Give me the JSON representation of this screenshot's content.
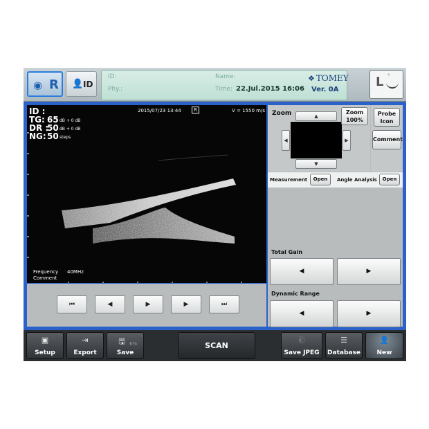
{
  "header": {
    "eye_button_label": "R",
    "id_button_label": "ID",
    "patient": {
      "id_label": "ID:",
      "name_label": "Name:",
      "phy_label": "Phy.:",
      "time_label": "Time:",
      "time_value": "22.Jul.2015  16:06"
    },
    "brand": "TOMEY",
    "version": "Ver. 0A",
    "probe_mode_label": "L"
  },
  "scan": {
    "date_time": "2015/07/23 13:44",
    "eye_badge": "R",
    "velocity": "V = 1550 m/s",
    "id_label": "ID :",
    "tg_label": "TG:",
    "tg_value": "65",
    "tg_unit": "dB + 0 dB",
    "dr_label": "DR :",
    "dr_value": "50",
    "dr_unit": "dB + 0 dB",
    "ng_label": "NG:",
    "ng_value": "50",
    "ng_unit": "steps",
    "frequency_label": "Frequency",
    "frequency_value": "40MHz",
    "comment_label": "Comment"
  },
  "playback": {
    "first_icon": "⏮",
    "prev_icon": "◀",
    "play_icon": "▶",
    "next_icon": "▶",
    "last_icon": "⏭"
  },
  "zoom": {
    "label": "Zoom",
    "zoom_button_line1": "Zoom",
    "zoom_button_line2": "100%",
    "probe_icon_line1": "Probe",
    "probe_icon_line2": "Icon",
    "comment_button": "Comment"
  },
  "analysis": {
    "measurement_label": "Measurement",
    "measurement_open": "Open",
    "angle_label": "Angle Analysis",
    "angle_open": "Open"
  },
  "controls": {
    "total_gain_label": "Total Gain",
    "dynamic_range_label": "Dynamic Range",
    "decrease_glyph": "◀",
    "increase_glyph": "▶"
  },
  "footer": {
    "setup": "Setup",
    "export": "Export",
    "save": "Save",
    "save_percent": "6%",
    "scan": "SCAN",
    "save_jpeg": "Save JPEG",
    "database": "Database",
    "new": "New"
  },
  "colors": {
    "accent_blue": "#2a62c9",
    "info_bar": "#cfe8df",
    "footer": "#2b2e31"
  }
}
